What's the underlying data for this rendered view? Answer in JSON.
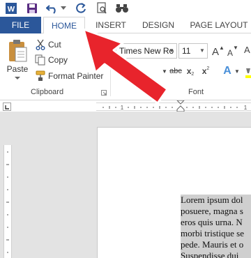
{
  "app": {
    "name": "Microsoft Word",
    "accent": "#2b579a"
  },
  "qat": {
    "items": [
      {
        "name": "word-logo-icon",
        "glyph": "W"
      },
      {
        "name": "save-icon",
        "glyph": "save"
      },
      {
        "name": "undo-icon",
        "glyph": "undo"
      },
      {
        "name": "redo-icon",
        "glyph": "redo"
      },
      {
        "name": "print-preview-icon",
        "glyph": "preview"
      },
      {
        "name": "find-icon",
        "glyph": "binoculars"
      }
    ]
  },
  "tabs": [
    {
      "id": "file",
      "label": "FILE",
      "active": false
    },
    {
      "id": "home",
      "label": "HOME",
      "active": true
    },
    {
      "id": "insert",
      "label": "INSERT",
      "active": false
    },
    {
      "id": "design",
      "label": "DESIGN",
      "active": false
    },
    {
      "id": "page_layout",
      "label": "PAGE LAYOUT",
      "active": false
    }
  ],
  "clipboard": {
    "paste_label": "Paste",
    "cut_label": "Cut",
    "copy_label": "Copy",
    "format_painter_label": "Format Painter",
    "group_label": "Clipboard"
  },
  "font": {
    "font_name": "Times New Ro",
    "font_size": "11",
    "group_label": "Font",
    "grow_label": "A",
    "shrink_label": "A",
    "bold_label": "B",
    "strike_label": "abc",
    "subscript_label": "x",
    "superscript_label": "x",
    "text_effects_label": "A"
  },
  "document": {
    "lines": [
      "Lorem ipsum dol",
      "posuere, magna s",
      "eros quis urna. N",
      "morbi tristique se",
      "pede. Mauris et o",
      "Suspendisse dui"
    ],
    "highlight_color": "#cfcfcf"
  },
  "annotation": {
    "arrow_color": "#e8242c"
  }
}
